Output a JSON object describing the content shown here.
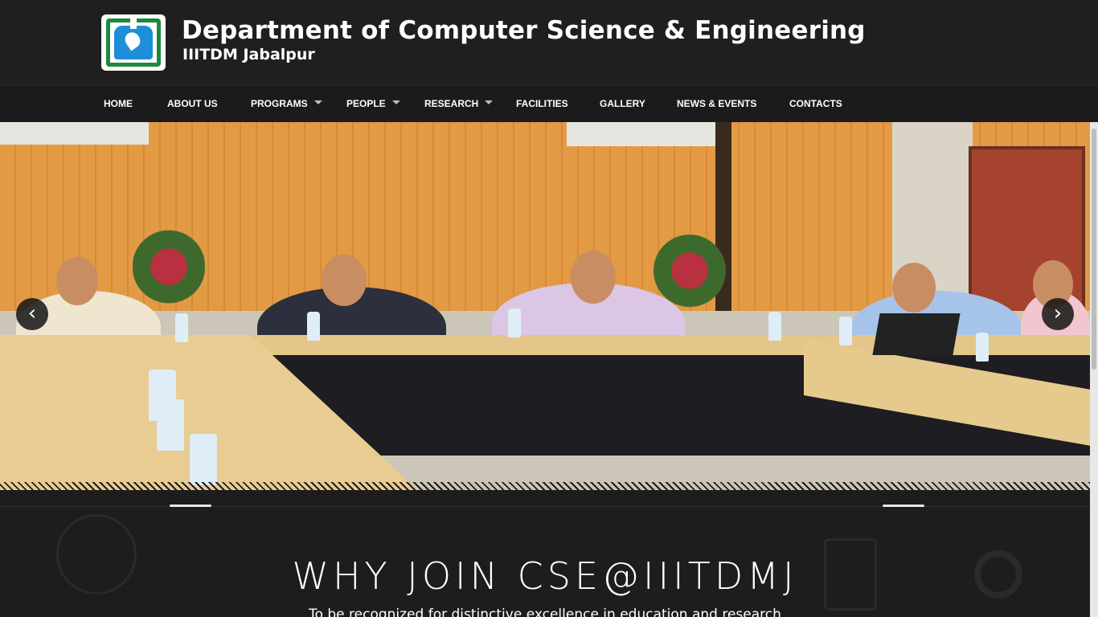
{
  "header": {
    "title": "Department of Computer Science & Engineering",
    "subtitle": "IIITDM Jabalpur",
    "logo_icon": "iiitdm-logo-icon"
  },
  "nav": {
    "items": [
      {
        "label": "HOME",
        "has_dropdown": false
      },
      {
        "label": "ABOUT US",
        "has_dropdown": false
      },
      {
        "label": "PROGRAMS",
        "has_dropdown": true
      },
      {
        "label": "PEOPLE",
        "has_dropdown": true
      },
      {
        "label": "RESEARCH",
        "has_dropdown": true
      },
      {
        "label": "FACILITIES",
        "has_dropdown": false
      },
      {
        "label": "GALLERY",
        "has_dropdown": false
      },
      {
        "label": "NEWS & EVENTS",
        "has_dropdown": false
      },
      {
        "label": "CONTACTS",
        "has_dropdown": false
      }
    ]
  },
  "slider": {
    "prev_icon": "chevron-left-icon",
    "prev_glyph": "‹",
    "next_icon": "chevron-right-icon",
    "next_glyph": "›"
  },
  "section": {
    "heading": "WHY JOIN CSE@IIITDMJ",
    "tagline": "To be recognized for distinctive excellence in education and research"
  },
  "colors": {
    "header_bg": "#1f1f1f",
    "nav_bg": "#1b1b1b",
    "text": "#ffffff"
  }
}
